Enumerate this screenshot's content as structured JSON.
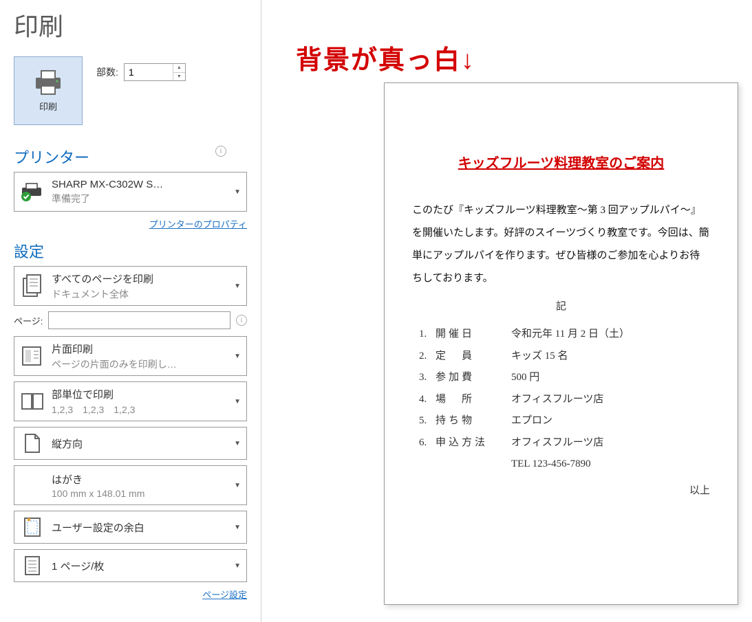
{
  "page_title": "印刷",
  "print_button_label": "印刷",
  "copies_label": "部数:",
  "copies_value": "1",
  "printer_section": "プリンター",
  "printer_name": "SHARP MX-C302W S…",
  "printer_status": "準備完了",
  "printer_properties_link": "プリンターのプロパティ",
  "settings_section": "設定",
  "print_what": {
    "main": "すべてのページを印刷",
    "sub": "ドキュメント全体"
  },
  "pages_label": "ページ:",
  "pages_value": "",
  "duplex": {
    "main": "片面印刷",
    "sub": "ページの片面のみを印刷し…"
  },
  "collate": {
    "main": "部単位で印刷",
    "sub": "1,2,3　1,2,3　1,2,3"
  },
  "orientation": {
    "main": "縦方向"
  },
  "paper_size": {
    "main": "はがき",
    "sub": "100 mm x 148.01 mm"
  },
  "margins": {
    "main": "ユーザー設定の余白"
  },
  "pages_per_sheet": {
    "main": "1 ページ/枚"
  },
  "page_setup_link": "ページ設定",
  "annotation_text": "背景が真っ白↓",
  "doc": {
    "title": "キッズフルーツ料理教室のご案内",
    "body": "このたび『キッズフルーツ料理教室〜第 3 回アップルパイ〜』を開催いたします。好評のスイーツづくり教室です。今回は、簡単にアップルパイを作ります。ぜひ皆様のご参加を心よりお待ちしております。",
    "ki": "記",
    "items": [
      {
        "num": "1.",
        "label": "開催日",
        "value": "令和元年 11 月 2 日（土）"
      },
      {
        "num": "2.",
        "label": "定　員",
        "value": "キッズ 15 名"
      },
      {
        "num": "3.",
        "label": "参加費",
        "value": "500 円"
      },
      {
        "num": "4.",
        "label": "場　所",
        "value": "オフィスフルーツ店"
      },
      {
        "num": "5.",
        "label": "持ち物",
        "value": "エプロン"
      },
      {
        "num": "6.",
        "label": "申込方法",
        "value": "オフィスフルーツ店"
      }
    ],
    "tel": "TEL 123-456-7890",
    "ijo": "以上"
  }
}
